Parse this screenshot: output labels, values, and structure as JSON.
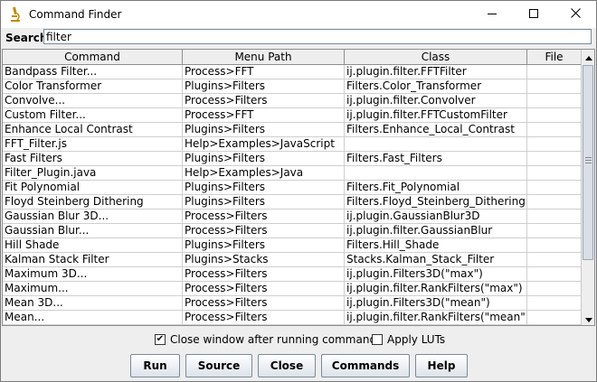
{
  "window": {
    "title": "Command Finder"
  },
  "search": {
    "label": "Search:",
    "value": "filter"
  },
  "table": {
    "columns": [
      "Command",
      "Menu Path",
      "Class",
      "File"
    ],
    "rows": [
      [
        "Bandpass Filter...",
        "Process>FFT",
        "ij.plugin.filter.FFTFilter",
        ""
      ],
      [
        "Color Transformer",
        "Plugins>Filters",
        "Filters.Color_Transformer",
        ""
      ],
      [
        "Convolve...",
        "Process>Filters",
        "ij.plugin.filter.Convolver",
        ""
      ],
      [
        "Custom Filter...",
        "Process>FFT",
        "ij.plugin.filter.FFTCustomFilter",
        ""
      ],
      [
        "Enhance Local Contrast",
        "Plugins>Filters",
        "Filters.Enhance_Local_Contrast",
        ""
      ],
      [
        "FFT_Filter.js",
        "Help>Examples>JavaScript",
        "",
        ""
      ],
      [
        "Fast Filters",
        "Plugins>Filters",
        "Filters.Fast_Filters",
        ""
      ],
      [
        "Filter_Plugin.java",
        "Help>Examples>Java",
        "",
        ""
      ],
      [
        "Fit Polynomial",
        "Plugins>Filters",
        "Filters.Fit_Polynomial",
        ""
      ],
      [
        "Floyd Steinberg Dithering",
        "Plugins>Filters",
        "Filters.Floyd_Steinberg_Dithering",
        ""
      ],
      [
        "Gaussian Blur 3D...",
        "Process>Filters",
        "ij.plugin.GaussianBlur3D",
        ""
      ],
      [
        "Gaussian Blur...",
        "Process>Filters",
        "ij.plugin.filter.GaussianBlur",
        ""
      ],
      [
        "Hill Shade",
        "Plugins>Filters",
        "Filters.Hill_Shade",
        ""
      ],
      [
        "Kalman Stack Filter",
        "Plugins>Stacks",
        "Stacks.Kalman_Stack_Filter",
        ""
      ],
      [
        "Maximum 3D...",
        "Process>Filters",
        "ij.plugin.Filters3D(\"max\")",
        ""
      ],
      [
        "Maximum...",
        "Process>Filters",
        "ij.plugin.filter.RankFilters(\"max\")",
        ""
      ],
      [
        "Mean 3D...",
        "Process>Filters",
        "ij.plugin.Filters3D(\"mean\")",
        ""
      ],
      [
        "Mean...",
        "Process>Filters",
        "ij.plugin.filter.RankFilters(\"mean\")",
        ""
      ]
    ]
  },
  "options": {
    "close_window": {
      "label": "Close window after running command",
      "checked": true
    },
    "apply_luts": {
      "label": "Apply LUTs",
      "checked": false
    }
  },
  "buttons": {
    "run": "Run",
    "source": "Source",
    "close": "Close",
    "commands": "Commands",
    "help": "Help"
  },
  "icons": {
    "app": "microscope-icon",
    "minimize": "minimize-icon",
    "maximize": "maximize-icon",
    "close": "close-icon",
    "scroll_up": "chevron-up-icon",
    "scroll_down": "chevron-down-icon",
    "check": "check-icon"
  },
  "colors": {
    "accent": "#c18a00",
    "button_border": "#7a8a99",
    "scroll_thumb": "#dadfe6"
  }
}
